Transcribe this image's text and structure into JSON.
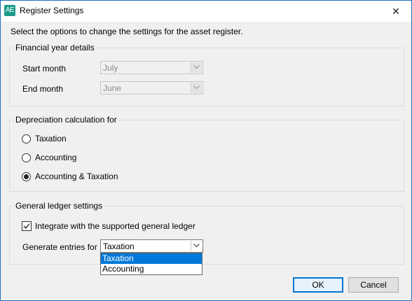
{
  "window": {
    "icon_text": "AE",
    "title": "Register Settings",
    "close_glyph": "✕"
  },
  "intro_text": "Select the options to change the settings for the asset register.",
  "financial_year": {
    "legend": "Financial year details",
    "start_month_label": "Start month",
    "start_month_value": "July",
    "end_month_label": "End month",
    "end_month_value": "June"
  },
  "depreciation": {
    "legend": "Depreciation calculation for",
    "options": [
      {
        "label": "Taxation",
        "checked": false
      },
      {
        "label": "Accounting",
        "checked": false
      },
      {
        "label": "Accounting & Taxation",
        "checked": true
      }
    ]
  },
  "general_ledger": {
    "legend": "General ledger settings",
    "integrate_label": "Integrate with the supported general ledger",
    "integrate_checked": true,
    "generate_label": "Generate entries for",
    "generate_value": "Taxation",
    "dropdown_options": [
      "Taxation",
      "Accounting"
    ],
    "dropdown_highlighted": "Taxation"
  },
  "buttons": {
    "ok": "OK",
    "cancel": "Cancel"
  },
  "colors": {
    "window_border": "#1f6fbf",
    "app_icon": "#1c9a8a",
    "selection": "#0078d7"
  },
  "icons": {
    "app": "app-logo-icon",
    "close": "close-icon",
    "combo_arrow": "chevron-down-icon",
    "check": "checkmark-icon"
  }
}
